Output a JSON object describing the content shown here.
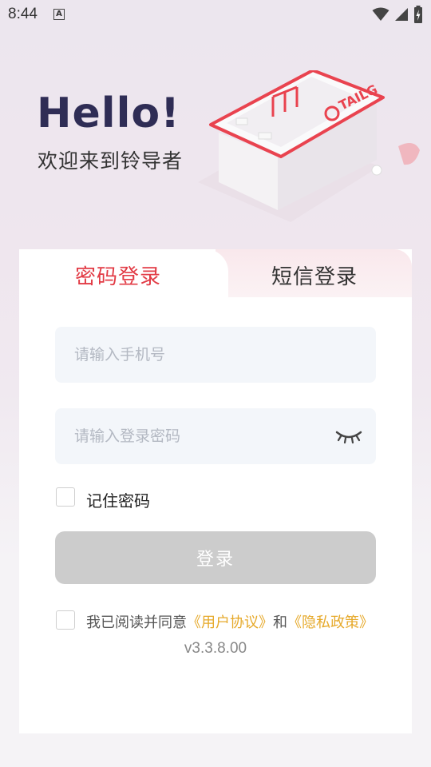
{
  "status_bar": {
    "time": "8:44",
    "notif_icon": "A"
  },
  "header": {
    "hello": "Hello!",
    "welcome": "欢迎来到铃导者"
  },
  "illustration": {
    "brand_logo_text": "TAILG"
  },
  "tabs": [
    {
      "label": "密码登录",
      "active": true
    },
    {
      "label": "短信登录",
      "active": false
    }
  ],
  "form": {
    "phone_placeholder": "请输入手机号",
    "password_placeholder": "请输入登录密码",
    "remember_label": "记住密码",
    "login_label": "登录"
  },
  "agreement": {
    "prefix": "我已阅读并同意",
    "user_agreement": "《用户协议》",
    "conjunction": "和",
    "privacy_policy": "《隐私政策》"
  },
  "version": "v3.3.8.00",
  "colors": {
    "accent_red": "#e23b45",
    "link_orange": "#e6a92a",
    "disabled_button": "#cccccc",
    "title_navy": "#2f2d55"
  }
}
